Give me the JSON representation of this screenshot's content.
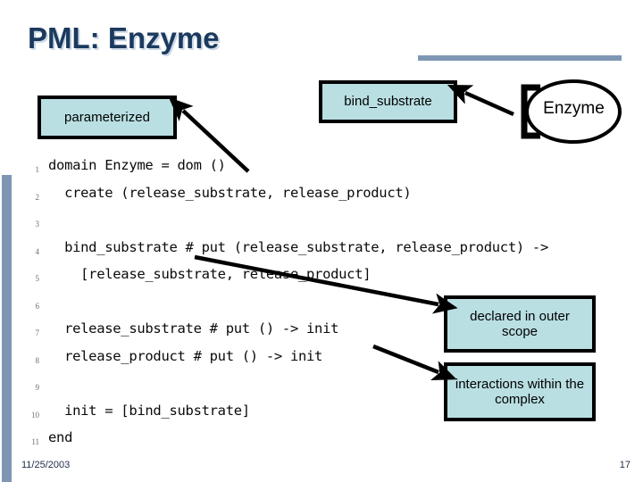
{
  "slide": {
    "title": "PML: Enzyme",
    "footer_date": "11/25/2003",
    "footer_page": "17"
  },
  "colors": {
    "title_text": "#1b3a5e",
    "title_shadow": "#cdd9e6",
    "rule": "#7e96b4",
    "callout_fill": "#b9dfe3",
    "callout_border": "#000000",
    "code_text": "#0b0b0b",
    "line_number": "#6e6e6e"
  },
  "code": {
    "lines": [
      {
        "n": "1",
        "text": "domain Enzyme = dom ()"
      },
      {
        "n": "2",
        "text": "  create (release_substrate, release_product)"
      },
      {
        "n": "3",
        "text": ""
      },
      {
        "n": "4",
        "text": "  bind_substrate # put (release_substrate, release_product) ->"
      },
      {
        "n": "5",
        "text": "    [release_substrate, release_product]"
      },
      {
        "n": "6",
        "text": ""
      },
      {
        "n": "7",
        "text": "  release_substrate # put () -> init"
      },
      {
        "n": "8",
        "text": "  release_product # put () -> init"
      },
      {
        "n": "9",
        "text": ""
      },
      {
        "n": "10",
        "text": "  init = [bind_substrate]"
      },
      {
        "n": "11",
        "text": "end"
      }
    ]
  },
  "callouts": {
    "parameterized": "parameterized",
    "bind_substrate": "bind_substrate",
    "declared_outer_scope": "declared in outer scope",
    "interactions_complex": "interactions within the complex"
  },
  "enzyme_node": {
    "label": "Enzyme",
    "shape": "ellipse-with-left-bracket"
  },
  "annotations": {
    "arrows": [
      {
        "name": "arrow-to-parameterized",
        "from": "code line 1 dom ()",
        "to": "parameterized callout"
      },
      {
        "name": "arrow-to-bind-substrate",
        "from": "Enzyme node bracket",
        "to": "bind_substrate callout"
      },
      {
        "name": "arrow-to-declared-outer-scope",
        "from": "code line 4 bind_substrate",
        "to": "declared in outer scope callout"
      },
      {
        "name": "arrow-to-interactions",
        "from": "code line 8 release_product",
        "to": "interactions within the complex callout"
      }
    ]
  }
}
